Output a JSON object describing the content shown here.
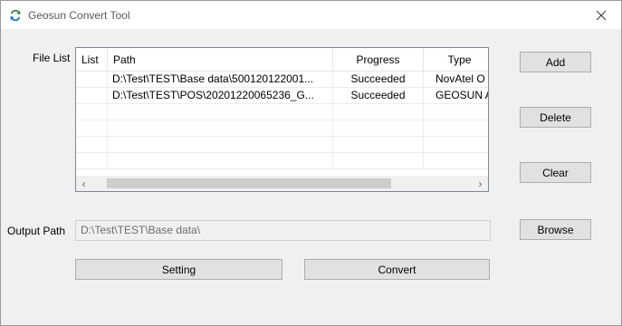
{
  "window": {
    "title": "Geosun Convert Tool",
    "icon": "geosun-app-icon",
    "close_icon": "close-icon"
  },
  "file_list": {
    "label": "File List",
    "columns": [
      "List",
      "Path",
      "Progress",
      "Type"
    ],
    "rows": [
      {
        "list": "",
        "path": "D:\\Test\\TEST\\Base data\\500120122001...",
        "progress": "Succeeded",
        "type": "NovAtel O"
      },
      {
        "list": "",
        "path": "D:\\Test\\TEST\\POS\\20201220065236_G...",
        "progress": "Succeeded",
        "type": "GEOSUN A"
      }
    ],
    "scroll_left_icon": "‹",
    "scroll_right_icon": "›"
  },
  "buttons": {
    "add": "Add",
    "delete": "Delete",
    "clear": "Clear",
    "browse": "Browse",
    "setting": "Setting",
    "convert": "Convert"
  },
  "output": {
    "label": "Output Path",
    "value": "D:\\Test\\TEST\\Base data\\"
  }
}
